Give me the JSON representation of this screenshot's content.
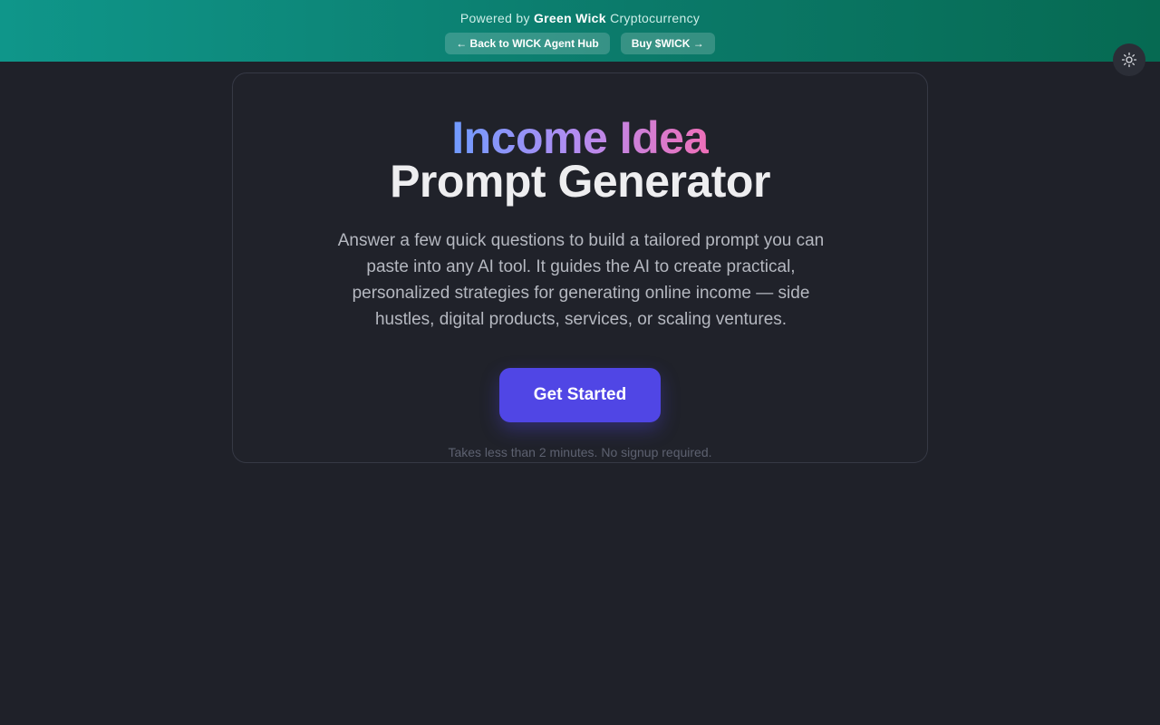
{
  "banner": {
    "prefix": "Powered by",
    "brand": "Green Wick",
    "suffix": "Cryptocurrency",
    "back_button": "← Back to WICK Agent Hub",
    "buy_button": "Buy $WICK →"
  },
  "theme_toggle": {
    "icon": "sun-icon"
  },
  "hero": {
    "title_line1": "Income Idea",
    "title_line2": "Prompt Generator",
    "description": "Answer a few quick questions to build a tailored prompt you can paste into any AI tool. It guides the AI to create practical, personalized strategies for generating online income — side hustles, digital products, services, or scaling ventures.",
    "cta_label": "Get Started",
    "note": "Takes less than 2 minutes. No signup required."
  },
  "colors": {
    "background": "#1f2129",
    "banner_start": "#0f968a",
    "banner_end": "#066a52",
    "accent": "#5046e5",
    "gradient_start": "#6f9bff",
    "gradient_end": "#ee6fb8"
  }
}
